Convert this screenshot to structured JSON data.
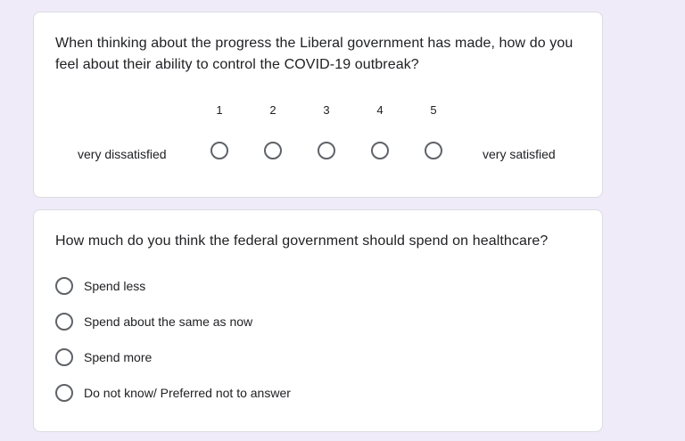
{
  "colors": {
    "page_background": "#f0ebf8",
    "card_background": "#ffffff",
    "radio_border": "#5f6368",
    "text": "#202124"
  },
  "q1": {
    "question": "When thinking about the progress the Liberal government has made, how do you feel about their ability to control the COVID-19 outbreak?",
    "scale_numbers": [
      "1",
      "2",
      "3",
      "4",
      "5"
    ],
    "low_label": "very dissatisfied",
    "high_label": "very satisfied",
    "selected": null
  },
  "q2": {
    "question": "How much do you think the federal government should spend on healthcare?",
    "options": [
      "Spend less",
      "Spend about the same as now",
      "Spend more",
      "Do not know/ Preferred not to answer"
    ],
    "selected": null
  }
}
